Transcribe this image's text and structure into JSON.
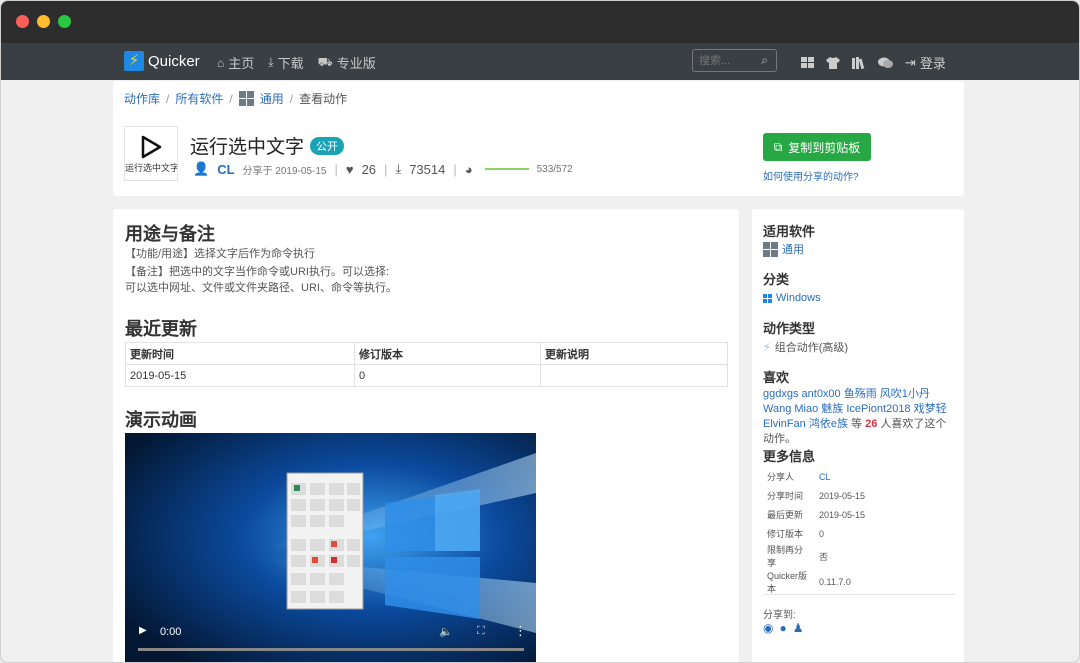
{
  "navbar": {
    "brand": "Quicker",
    "links": [
      {
        "icon": "home-icon",
        "glyph": "⌂",
        "label": "主页"
      },
      {
        "icon": "download-icon",
        "glyph": "⤓",
        "label": "下载"
      },
      {
        "icon": "cart-icon",
        "glyph": "⛟",
        "label": "专业版"
      }
    ],
    "search_placeholder": "搜索...",
    "login": "登录"
  },
  "breadcrumb": {
    "items": [
      "动作库",
      "所有软件",
      "通用"
    ],
    "current": "查看动作"
  },
  "action": {
    "thumb_label": "运行选中文字",
    "title": "运行选中文字",
    "badge": "公开",
    "author": "CL",
    "shared_text": "分享于 2019-05-15",
    "likes": "26",
    "downloads": "73514",
    "progress_text": "533/572",
    "progress_fraction": 0.93,
    "copy_button": "复制到剪贴板",
    "howto_link": "如何使用分享的动作?"
  },
  "main": {
    "usage_title": "用途与备注",
    "usage_line1": "【功能/用途】选择文字后作为命令执行",
    "usage_line2": "【备注】把选中的文字当作命令或URI执行。可以选择:",
    "usage_line3": "可以选中网址、文件或文件夹路径、URI、命令等执行。",
    "updates_title": "最近更新",
    "table_headers": [
      "更新时间",
      "修订版本",
      "更新说明"
    ],
    "table_rows": [
      [
        "2019-05-15",
        "0",
        ""
      ]
    ],
    "demo_title": "演示动画",
    "video_time": "0:00"
  },
  "sidebar": {
    "software_title": "适用软件",
    "software_value": "通用",
    "category_title": "分类",
    "category_value": "Windows",
    "type_title": "动作类型",
    "type_value": "组合动作(高级)",
    "likes_title": "喜欢",
    "likes_users": "ggdxgs ant0x00 鱼殇雨 风吹1小丹 Wang Miao 魅族 IcePiont2018 戏梦轻 ElvinFan 鸿依e族",
    "likes_prefix": "等",
    "likes_count": "26",
    "likes_suffix": "人喜欢了这个动作。",
    "more_title": "更多信息",
    "info": [
      {
        "k": "分享人",
        "v": "CL"
      },
      {
        "k": "分享时间",
        "v": "2019-05-15"
      },
      {
        "k": "最后更新",
        "v": "2019-05-15"
      },
      {
        "k": "修订版本",
        "v": "0"
      },
      {
        "k": "限制再分享",
        "v": "否"
      },
      {
        "k": "Quicker版本",
        "v": "0.11.7.0"
      }
    ],
    "share_label": "分享到:"
  },
  "colors": {
    "accent": "#2a6ebb",
    "copy_button": "#28a745",
    "navbar": "#3a3f44",
    "badge": "#1aa3b5"
  }
}
